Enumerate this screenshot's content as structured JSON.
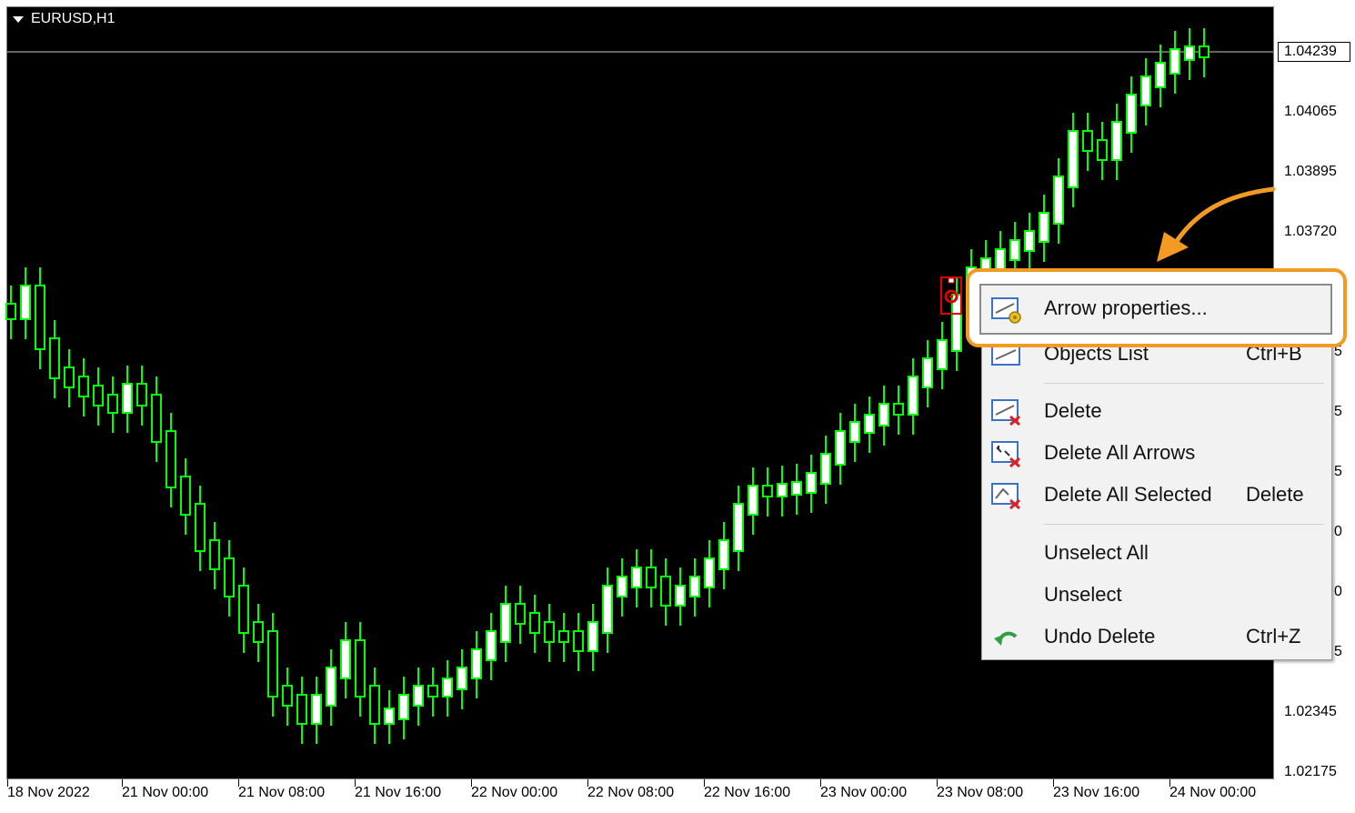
{
  "chart": {
    "symbol_label": "EURUSD,H1",
    "current_price": "1.04239",
    "y_ticks": [
      "1.04065",
      "1.03895",
      "1.03720",
      "1.02345",
      "1.02175"
    ],
    "y_ticks_partial": [
      "5",
      "5",
      "5",
      "0",
      "0",
      "5"
    ],
    "x_ticks": [
      "18 Nov 2022",
      "21 Nov 00:00",
      "21 Nov 08:00",
      "21 Nov 16:00",
      "22 Nov 00:00",
      "22 Nov 08:00",
      "22 Nov 16:00",
      "23 Nov 00:00",
      "23 Nov 08:00",
      "23 Nov 16:00",
      "24 Nov 00:00"
    ],
    "colors": {
      "background": "#000000",
      "candle": "#00ff00",
      "bull_body": "#ffffff",
      "marker": "#e00000",
      "highlight": "#f39a23"
    }
  },
  "context_menu": {
    "items": [
      {
        "label": "Arrow properties...",
        "shortcut": "",
        "icon": "arrow-properties-icon"
      },
      {
        "label": "Objects List",
        "shortcut": "Ctrl+B",
        "icon": "objects-list-icon"
      },
      {
        "label": "Delete",
        "shortcut": "",
        "icon": "delete-icon"
      },
      {
        "label": "Delete All Arrows",
        "shortcut": "",
        "icon": "delete-all-arrows-icon"
      },
      {
        "label": "Delete All Selected",
        "shortcut": "Delete",
        "icon": "delete-all-selected-icon"
      },
      {
        "label": "Unselect All",
        "shortcut": "",
        "icon": ""
      },
      {
        "label": "Unselect",
        "shortcut": "",
        "icon": ""
      },
      {
        "label": "Undo Delete",
        "shortcut": "Ctrl+Z",
        "icon": "undo-icon"
      }
    ]
  }
}
